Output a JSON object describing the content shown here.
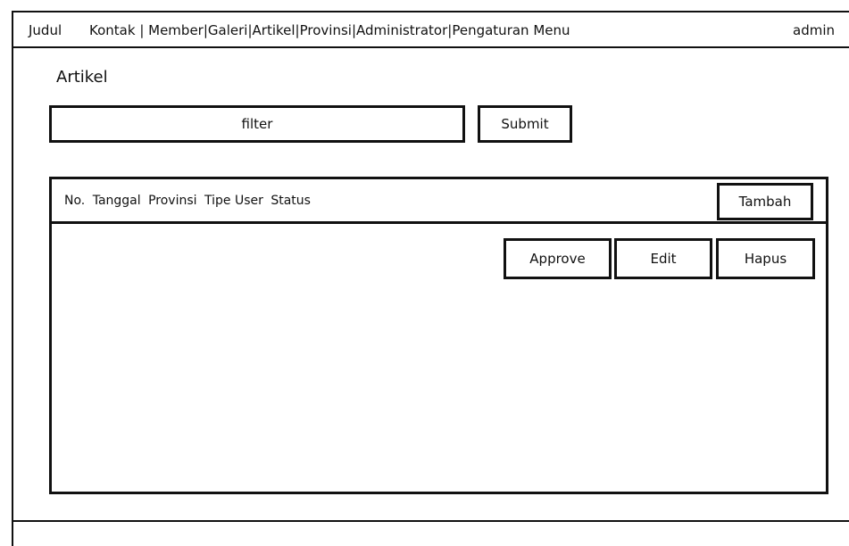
{
  "topbar": {
    "brand": "Judul",
    "nav": [
      {
        "label": "Kontak",
        "sep": " | "
      },
      {
        "label": "Member",
        "sep": "|"
      },
      {
        "label": "Galeri",
        "sep": "|"
      },
      {
        "label": "Artikel",
        "sep": "|"
      },
      {
        "label": "Provinsi",
        "sep": "|"
      },
      {
        "label": "Administrator",
        "sep": "|"
      },
      {
        "label": "Pengaturan Menu",
        "sep": ""
      }
    ],
    "user": "admin"
  },
  "page": {
    "title": "Artikel"
  },
  "filter": {
    "placeholder": "filter",
    "submit_label": "Submit"
  },
  "table": {
    "columns": [
      "No.",
      "Tanggal",
      "Provinsi",
      "Tipe User",
      "Status"
    ],
    "add_label": "Tambah",
    "row_actions": {
      "approve": "Approve",
      "edit": "Edit",
      "delete": "Hapus"
    }
  }
}
